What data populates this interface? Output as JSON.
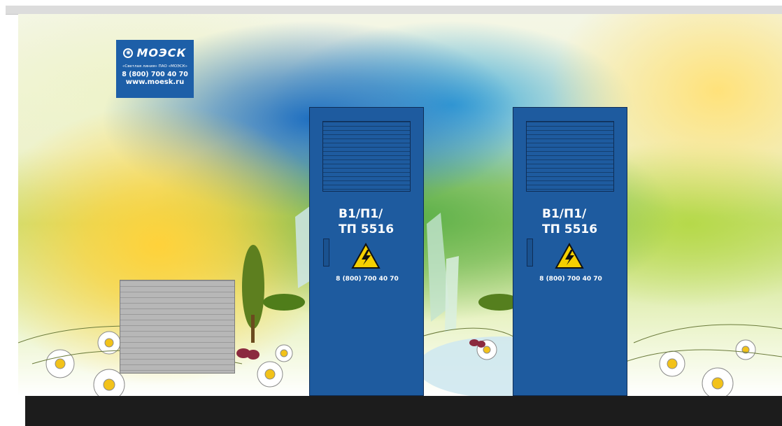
{
  "logo": {
    "brand": "МОЭСК",
    "subtitle": "«Светлая линия» ПАО «МОЭСК»",
    "phone": "8 (800) 700 40 70",
    "url": "www.moesk.ru",
    "color": "#1d5fa8"
  },
  "doors": [
    {
      "label_line1": "В1/П1/",
      "label_line2": "ТП 5516",
      "phone": "8 (800) 700 40 70",
      "icon": "high-voltage-warning-icon"
    },
    {
      "label_line1": "В1/П1/",
      "label_line2": "ТП 5516",
      "phone": "8 (800) 700 40 70",
      "icon": "high-voltage-warning-icon"
    }
  ],
  "colors": {
    "door": "#1e5b9f",
    "warning": "#f5d000",
    "base": "#1c1c1c"
  }
}
